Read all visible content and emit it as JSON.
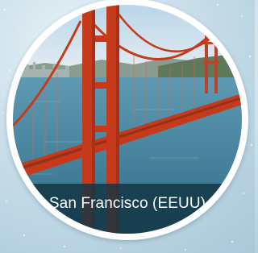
{
  "card": {
    "city_label": "San Francisco (EEUU)",
    "image_subject": "golden-gate-bridge"
  },
  "colors": {
    "bridge": "#c63a1c",
    "water": "#3f7f9a",
    "caption_band": "#113442",
    "caption_text": "#ffffff",
    "ring": "#ffffff"
  }
}
